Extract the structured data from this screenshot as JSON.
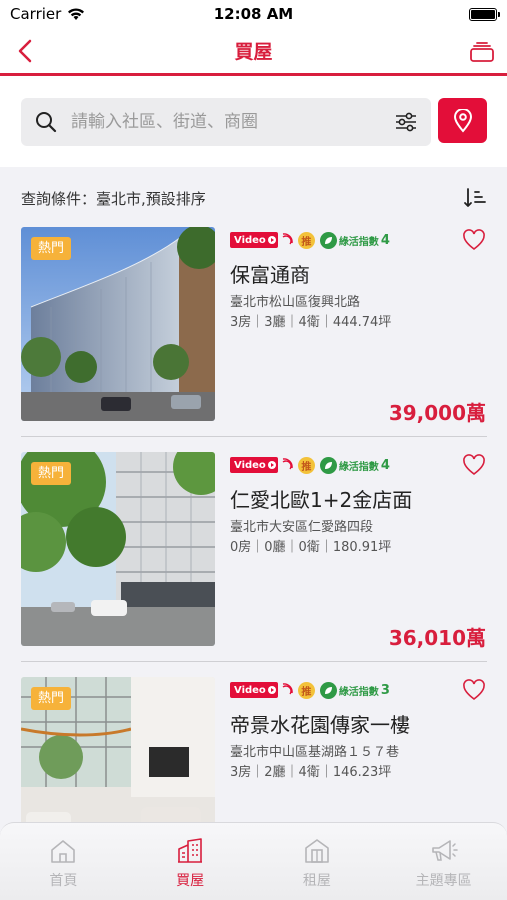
{
  "status": {
    "carrier": "Carrier",
    "time": "12:08 AM"
  },
  "nav": {
    "title": "買屋",
    "back_icon": "chevron-left-icon",
    "stack_icon": "stack-icon"
  },
  "search": {
    "placeholder": "請輸入社區、街道、商圈",
    "value": ""
  },
  "query": {
    "text": "查詢條件：臺北市,預設排序"
  },
  "listings": [
    {
      "hot": "熱門",
      "video_label": "Video",
      "recommend": "推",
      "green_label": "綠活指數",
      "green_score": "4",
      "name": "保富通商",
      "address": "臺北市松山區復興北路",
      "spec": "3房｜3廳｜4衛｜444.74坪",
      "price": "39,000萬"
    },
    {
      "hot": "熱門",
      "video_label": "Video",
      "recommend": "推",
      "green_label": "綠活指數",
      "green_score": "4",
      "name": "仁愛北歐1+2金店面",
      "address": "臺北市大安區仁愛路四段",
      "spec": "0房｜0廳｜0衛｜180.91坪",
      "price": "36,010萬"
    },
    {
      "hot": "熱門",
      "video_label": "Video",
      "recommend": "推",
      "green_label": "綠活指數",
      "green_score": "3",
      "name": "帝景水花園傳家一樓",
      "address": "臺北市中山區基湖路１５７巷",
      "spec": "3房｜2廳｜4衛｜146.23坪",
      "price": ""
    }
  ],
  "tabs": [
    {
      "label": "首頁",
      "icon": "home-icon"
    },
    {
      "label": "買屋",
      "icon": "building-icon"
    },
    {
      "label": "租屋",
      "icon": "rent-house-icon"
    },
    {
      "label": "主題專區",
      "icon": "megaphone-icon"
    }
  ],
  "colors": {
    "brand": "#d81e3d",
    "price": "#d81e3d",
    "hot": "#f6b23a",
    "green": "#2f9a45"
  }
}
